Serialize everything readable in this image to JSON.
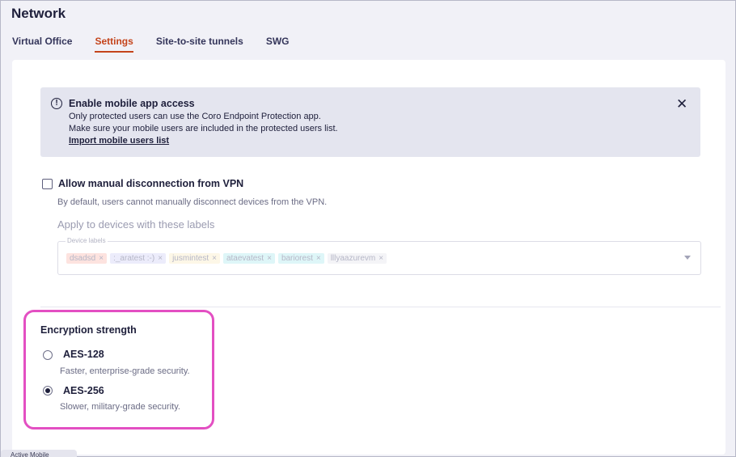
{
  "page": {
    "title": "Network"
  },
  "tabs": [
    {
      "label": "Virtual Office",
      "active": false
    },
    {
      "label": "Settings",
      "active": true
    },
    {
      "label": "Site-to-site tunnels",
      "active": false
    },
    {
      "label": "SWG",
      "active": false
    }
  ],
  "alert": {
    "icon": "info-alert-icon",
    "title": "Enable mobile app access",
    "line1": "Only protected users can use the Coro Endpoint Protection app.",
    "line2": "Make sure your mobile users are included in the protected users list.",
    "link": "Import mobile users list",
    "close_icon": "close-icon"
  },
  "vpn": {
    "checkbox_label": "Allow manual disconnection from VPN",
    "checked": false,
    "description": "By default, users cannot manually disconnect devices from the VPN.",
    "apply_label": "Apply to devices with these labels",
    "field_legend": "Device labels",
    "chips": [
      {
        "label": "dsadsd",
        "color": "#fde3df"
      },
      {
        "label": ":_aratest :-)",
        "color": "#ececfb"
      },
      {
        "label": "jusmintest",
        "color": "#fdf7e7"
      },
      {
        "label": "ataevatest",
        "color": "#def6f8"
      },
      {
        "label": "bariorest",
        "color": "#def6f8"
      },
      {
        "label": "lllyaazurevm",
        "color": "#f4f4f7"
      }
    ]
  },
  "encryption": {
    "title": "Encryption strength",
    "highlight_color": "#e34fc2",
    "options": [
      {
        "label": "AES-128",
        "description": "Faster, enterprise-grade security.",
        "selected": false
      },
      {
        "label": "AES-256",
        "description": "Slower, military-grade security.",
        "selected": true
      }
    ]
  },
  "footer": {
    "tab_label": "Active Mobile"
  }
}
